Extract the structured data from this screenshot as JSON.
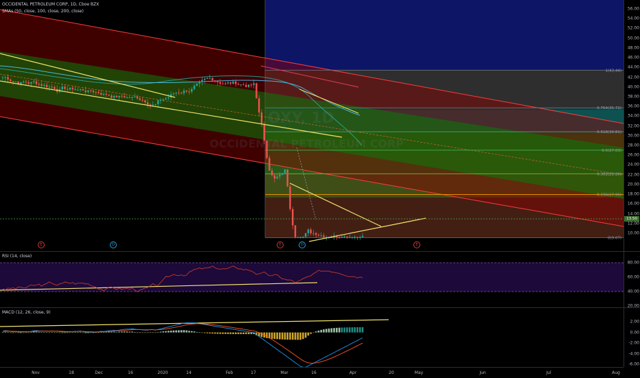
{
  "header": {
    "symbol_line": "OCCIDENTAL PETROLEUM CORP, 1D, Cboe BZX",
    "indicator_line": "SMAs (50, close, 100, close, 200, close)"
  },
  "watermark": {
    "ticker": "OXY, 1D",
    "name": "OCCIDENTAL PETROLEUM CORP"
  },
  "price_axis": [
    "56.00",
    "54.00",
    "52.00",
    "50.00",
    "48.00",
    "46.00",
    "44.00",
    "42.00",
    "40.00",
    "38.00",
    "36.00",
    "34.00",
    "32.00",
    "30.00",
    "28.00",
    "26.00",
    "24.00",
    "22.00",
    "20.00",
    "18.00",
    "16.00",
    "14.00",
    "12.00",
    "10.00"
  ],
  "last_price": "13.50",
  "fib_levels": [
    {
      "label": "1(43.44)",
      "value": 43.44,
      "color": "#787b86"
    },
    {
      "label": "0.764(35.72)",
      "value": 35.72,
      "color": "#2196a8"
    },
    {
      "label": "0.618(30.81)",
      "value": 30.81,
      "color": "#4caf50"
    },
    {
      "label": "0.5(27.03)",
      "value": 27.03,
      "color": "#4caf50"
    },
    {
      "label": "0.382(22.20)",
      "value": 22.2,
      "color": "#8bc34a"
    },
    {
      "label": "0.236(17.96)",
      "value": 17.96,
      "color": "#ff9800"
    },
    {
      "label": "0(9.07)",
      "value": 9.07,
      "color": "#787b86"
    }
  ],
  "events": [
    {
      "letter": "E",
      "type": "earnings"
    },
    {
      "letter": "D",
      "type": "dividend"
    },
    {
      "letter": "E",
      "type": "earnings"
    },
    {
      "letter": "D",
      "type": "dividend"
    },
    {
      "letter": "E",
      "type": "earnings"
    }
  ],
  "rsi": {
    "title": "RSI (14, close)",
    "axis": [
      "80.00",
      "60.00",
      "40.00",
      "20.00"
    ]
  },
  "macd": {
    "title": "MACD (12, 26, close, 9)",
    "axis": [
      "2.00",
      "0.00",
      "-2.00",
      "-4.00",
      "-6.00"
    ]
  },
  "time_axis": [
    "Nov",
    "18",
    "Dec",
    "16",
    "2020",
    "14",
    "Feb",
    "17",
    "Mar",
    "16",
    "Apr",
    "20",
    "May",
    "Jun",
    "Jul",
    "Aug"
  ],
  "colors": {
    "up": "#26a69a",
    "down": "#ef5350",
    "sma": "#f2e36b",
    "rsi": "#c0392b",
    "macd": "#2196f3",
    "signal": "#ff5722"
  }
}
